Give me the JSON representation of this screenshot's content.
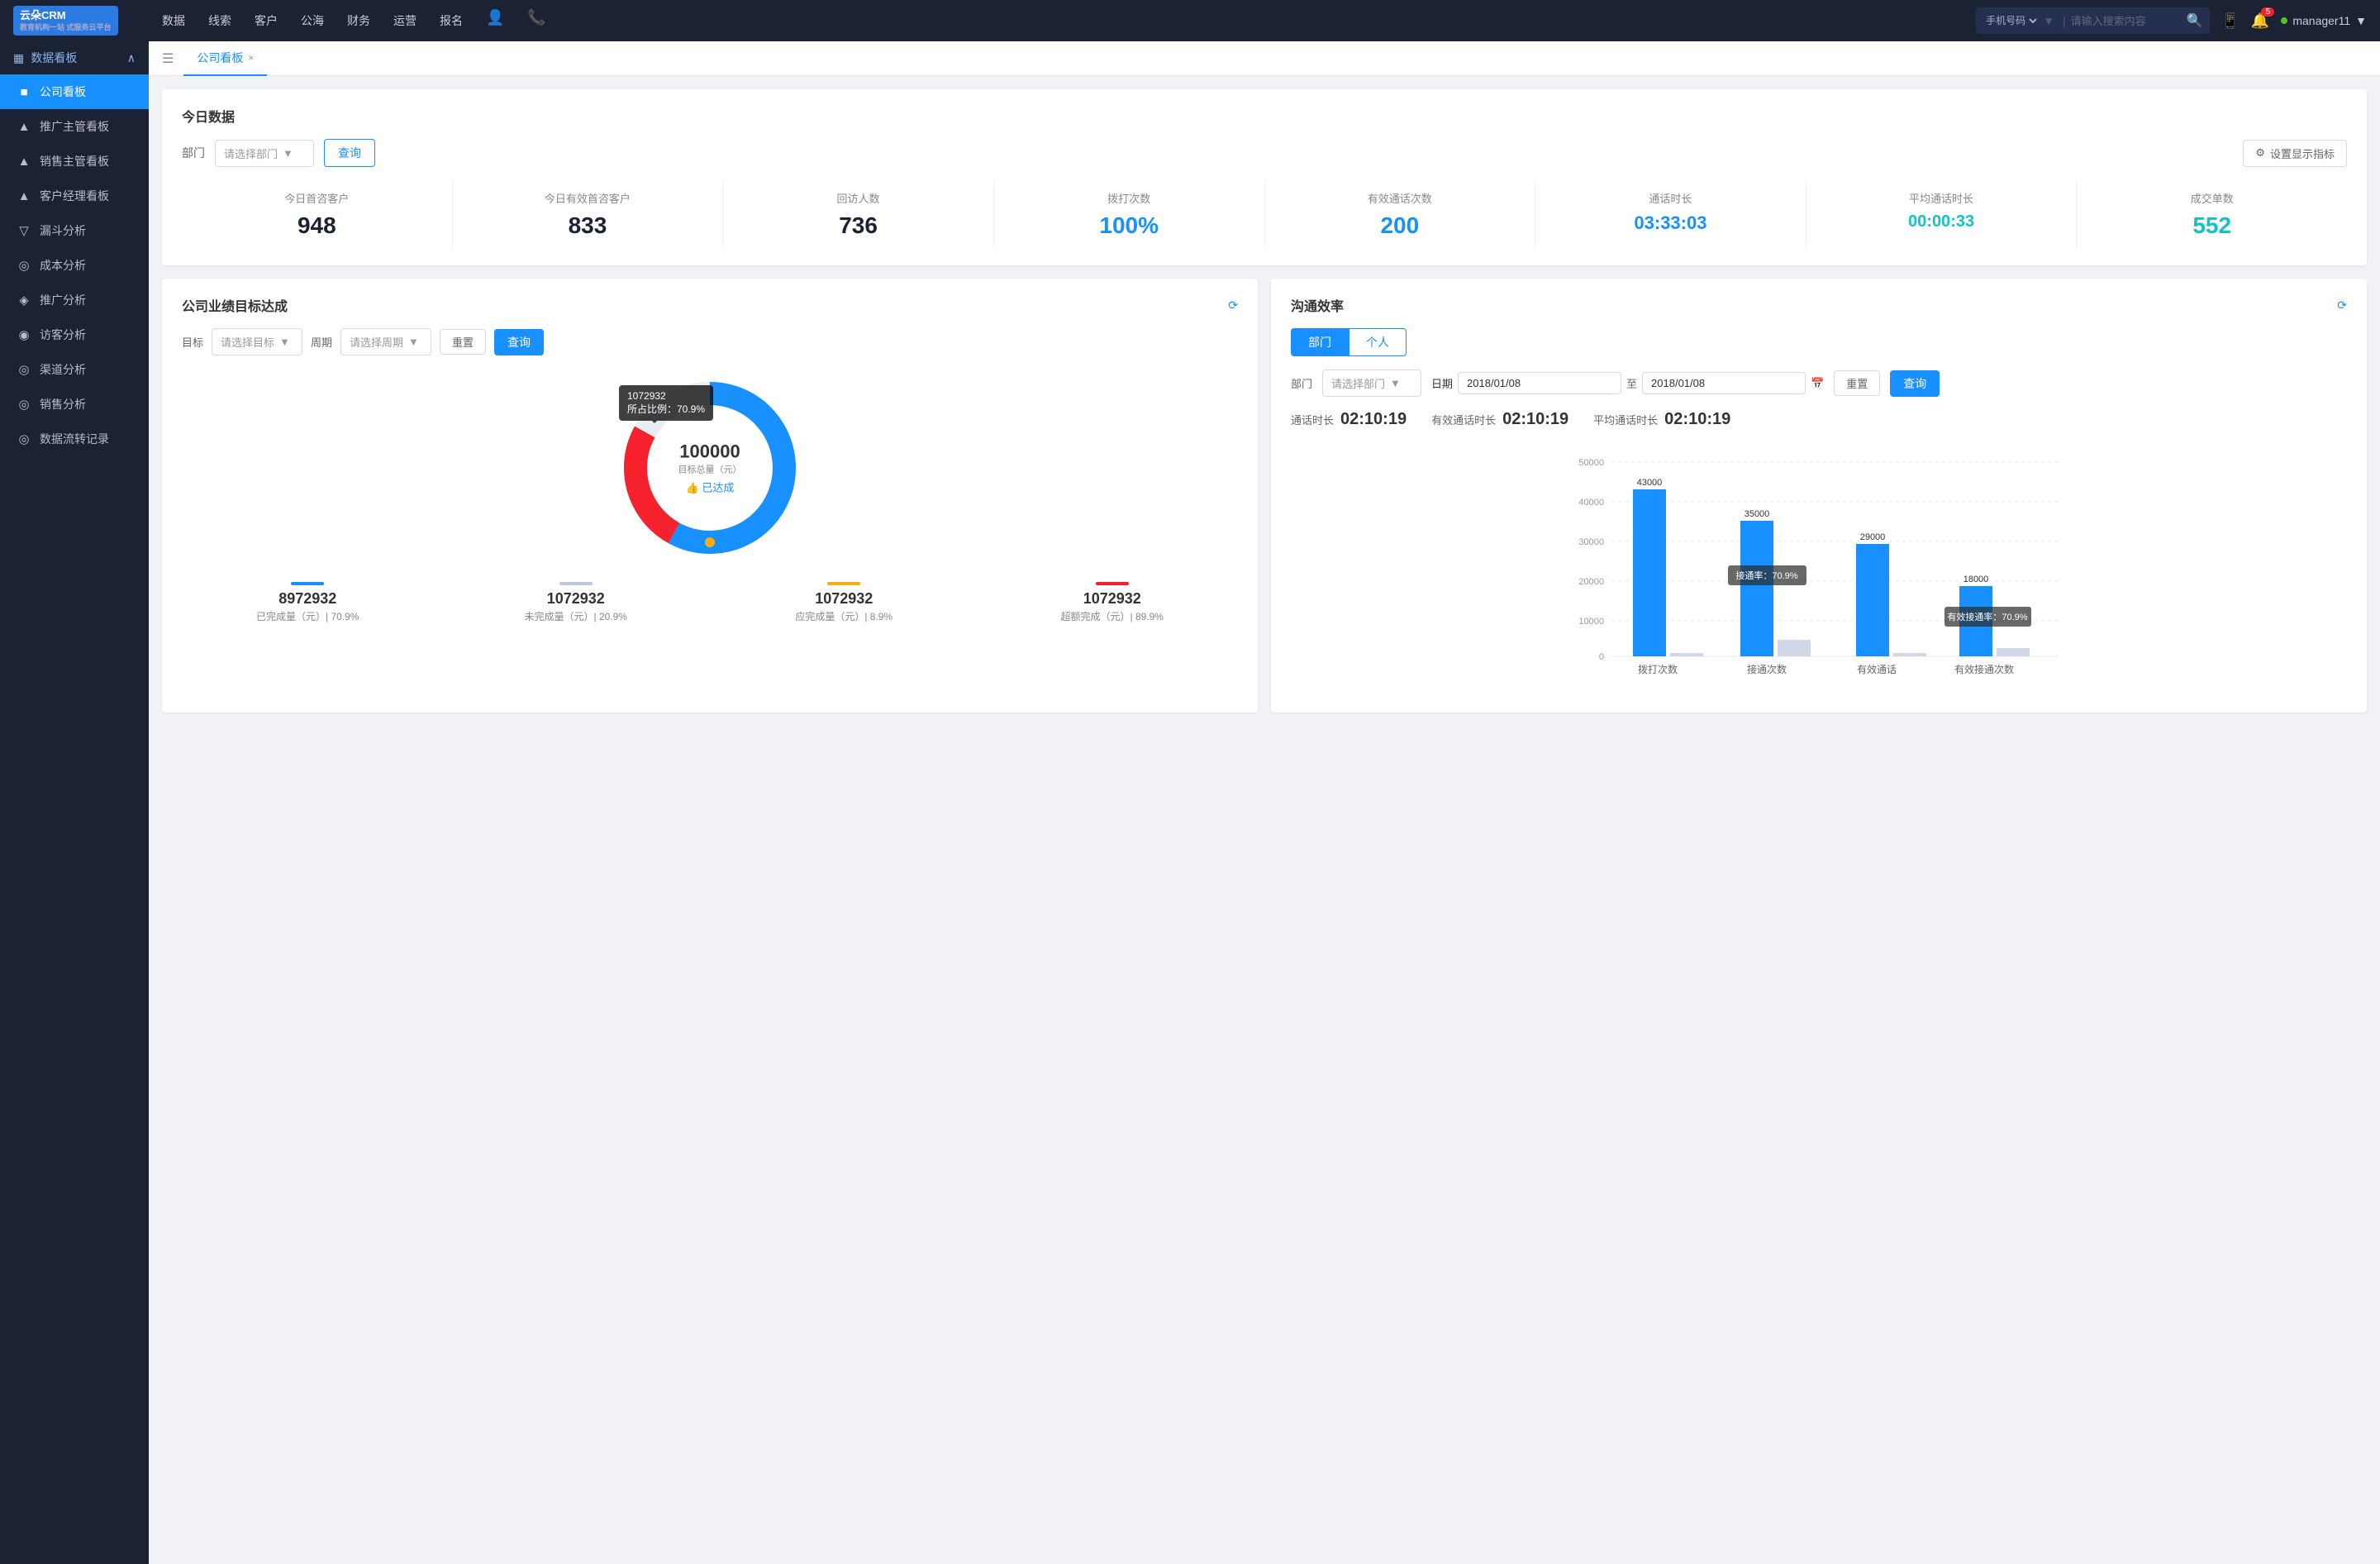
{
  "topNav": {
    "logo": "云朵CRM",
    "logoSub": "教育机构一站\n式服务云平台",
    "items": [
      "数据",
      "线索",
      "客户",
      "公海",
      "财务",
      "运营",
      "报名"
    ],
    "searchPlaceholder": "请输入搜索内容",
    "searchSelectLabel": "手机号码",
    "bellCount": "5",
    "userStatus": "manager11"
  },
  "sidebar": {
    "dashboardLabel": "数据看板",
    "items": [
      {
        "label": "公司看板",
        "icon": "■",
        "active": true
      },
      {
        "label": "推广主管看板",
        "icon": "▲",
        "active": false
      },
      {
        "label": "销售主管看板",
        "icon": "▲",
        "active": false
      },
      {
        "label": "客户经理看板",
        "icon": "▲",
        "active": false
      },
      {
        "label": "漏斗分析",
        "icon": "▽",
        "active": false
      },
      {
        "label": "成本分析",
        "icon": "◎",
        "active": false
      },
      {
        "label": "推广分析",
        "icon": "◈",
        "active": false
      },
      {
        "label": "访客分析",
        "icon": "◉",
        "active": false
      },
      {
        "label": "渠道分析",
        "icon": "◎",
        "active": false
      },
      {
        "label": "销售分析",
        "icon": "◎",
        "active": false
      },
      {
        "label": "数据流转记录",
        "icon": "◎",
        "active": false
      }
    ]
  },
  "tab": {
    "label": "公司看板"
  },
  "todaySection": {
    "title": "今日数据",
    "deptLabel": "部门",
    "deptPlaceholder": "请选择部门",
    "queryBtn": "查询",
    "settingsBtn": "设置显示指标",
    "metrics": [
      {
        "label": "今日首咨客户",
        "value": "948",
        "color": "dark"
      },
      {
        "label": "今日有效首咨客户",
        "value": "833",
        "color": "dark"
      },
      {
        "label": "回访人数",
        "value": "736",
        "color": "dark"
      },
      {
        "label": "拨打次数",
        "value": "100%",
        "color": "blue"
      },
      {
        "label": "有效通话次数",
        "value": "200",
        "color": "blue"
      },
      {
        "label": "通话时长",
        "value": "03:33:03",
        "color": "blue"
      },
      {
        "label": "平均通话时长",
        "value": "00:00:33",
        "color": "cyan"
      },
      {
        "label": "成交单数",
        "value": "552",
        "color": "cyan"
      }
    ]
  },
  "targetSection": {
    "title": "公司业绩目标达成",
    "targetLabel": "目标",
    "targetPlaceholder": "请选择目标",
    "periodLabel": "周期",
    "periodPlaceholder": "请选择周期",
    "resetBtn": "重置",
    "queryBtn": "查询",
    "donut": {
      "value": "100000",
      "sublabel": "目标总量（元）",
      "status": "👍 已达成",
      "tooltip": {
        "line1": "1072932",
        "line2": "所占比例：70.9%"
      },
      "segments": [
        {
          "label": "已完成量",
          "color": "#1890ff",
          "percent": 70.9
        },
        {
          "label": "未完成量",
          "color": "#d0d8e8",
          "percent": 20.9
        },
        {
          "label": "应完成量",
          "color": "#faad14",
          "percent": 8.9
        },
        {
          "label": "超额完成量",
          "color": "#f5222d",
          "percent": 89.9
        }
      ]
    },
    "legend": [
      {
        "label": "已完成量（元）| 70.9%",
        "value": "8972932",
        "color": "#1890ff"
      },
      {
        "label": "未完成量（元）| 20.9%",
        "value": "1072932",
        "color": "#d0d8e8"
      },
      {
        "label": "应完成量（元）| 8.9%",
        "value": "1072932",
        "color": "#faad14"
      },
      {
        "label": "超额完成（元）| 89.9%",
        "value": "1072932",
        "color": "#f5222d"
      }
    ]
  },
  "commSection": {
    "title": "沟通效率",
    "tabs": [
      "部门",
      "个人"
    ],
    "activeTab": "部门",
    "deptLabel": "部门",
    "deptPlaceholder": "请选择部门",
    "dateLabel": "日期",
    "dateFrom": "2018/01/08",
    "dateTo": "2018/01/08",
    "resetBtn": "重置",
    "queryBtn": "查询",
    "stats": [
      {
        "label": "通话时长",
        "value": "02:10:19"
      },
      {
        "label": "有效通话时长",
        "value": "02:10:19"
      },
      {
        "label": "平均通话时长",
        "value": "02:10:19"
      }
    ],
    "chart": {
      "yLabels": [
        "50000",
        "40000",
        "30000",
        "20000",
        "10000",
        "0"
      ],
      "groups": [
        {
          "label": "拨打次数",
          "bars": [
            {
              "value": 43000,
              "color": "#1890ff",
              "height": 86,
              "label": "43000"
            },
            {
              "value": 0,
              "color": "#d0d8e8",
              "height": 4,
              "label": ""
            }
          ]
        },
        {
          "label": "接通次数",
          "annotation": "接通率：70.9%",
          "bars": [
            {
              "value": 35000,
              "color": "#1890ff",
              "height": 70,
              "label": "35000"
            },
            {
              "value": 0,
              "color": "#d0d8e8",
              "height": 20,
              "label": ""
            }
          ]
        },
        {
          "label": "有效通话",
          "bars": [
            {
              "value": 29000,
              "color": "#1890ff",
              "height": 58,
              "label": "29000"
            },
            {
              "value": 0,
              "color": "#d0d8e8",
              "height": 4,
              "label": ""
            }
          ]
        },
        {
          "label": "有效接通次数",
          "annotation": "有效接通率：70.9%",
          "bars": [
            {
              "value": 18000,
              "color": "#1890ff",
              "height": 36,
              "label": "18000"
            },
            {
              "value": 0,
              "color": "#d0d8e8",
              "height": 10,
              "label": ""
            }
          ]
        }
      ]
    }
  }
}
